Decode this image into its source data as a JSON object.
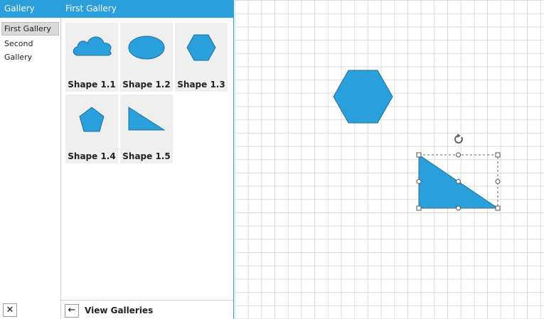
{
  "galleries": {
    "header": "Gallery",
    "items": [
      {
        "label": "First Gallery",
        "selected": true
      },
      {
        "label": "Second Gallery",
        "selected": false
      }
    ],
    "close_icon": "close-icon"
  },
  "panel": {
    "header": "First Gallery",
    "shapes": [
      {
        "label": "Shape 1.1",
        "icon": "cloud-icon"
      },
      {
        "label": "Shape 1.2",
        "icon": "ellipse-icon"
      },
      {
        "label": "Shape 1.3",
        "icon": "hexagon-icon"
      },
      {
        "label": "Shape 1.4",
        "icon": "pentagon-icon"
      },
      {
        "label": "Shape 1.5",
        "icon": "right-triangle-icon"
      }
    ],
    "footer": {
      "back_icon": "arrow-left-icon",
      "label": "View Galleries"
    }
  },
  "canvas": {
    "shapes": [
      {
        "type": "hexagon",
        "selected": false
      },
      {
        "type": "right-triangle",
        "selected": true
      }
    ],
    "rotate_icon": "rotate-icon"
  },
  "colors": {
    "accent": "#2a9fdb",
    "shape_fill": "#299fdc",
    "shape_stroke": "#1f6f9c",
    "tile_bg": "#efefef",
    "grid": "#dcdcdc"
  }
}
